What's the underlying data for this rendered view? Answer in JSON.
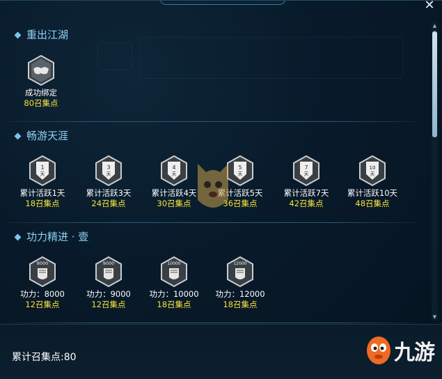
{
  "window": {
    "close_icon": "close-icon"
  },
  "sections": [
    {
      "title": "重出江湖",
      "items": [
        {
          "name": "成功绑定",
          "points": "80召集点",
          "icon": "handshake-badge-icon"
        }
      ]
    },
    {
      "title": "畅游天涯",
      "items": [
        {
          "name": "累计活跃1天",
          "points": "18召集点",
          "icon": "shield-badge-icon",
          "badge_text": "1天"
        },
        {
          "name": "累计活跃3天",
          "points": "24召集点",
          "icon": "shield-badge-icon",
          "badge_text": "3天"
        },
        {
          "name": "累计活跃4天",
          "points": "30召集点",
          "icon": "shield-badge-icon",
          "badge_text": "4天"
        },
        {
          "name": "累计活跃5天",
          "points": "36召集点",
          "icon": "shield-badge-icon",
          "badge_text": "5天"
        },
        {
          "name": "累计活跃7天",
          "points": "42召集点",
          "icon": "shield-badge-icon",
          "badge_text": "7天"
        },
        {
          "name": "累计活跃10天",
          "points": "48召集点",
          "icon": "shield-badge-icon",
          "badge_text": "10天"
        }
      ]
    },
    {
      "title": "功力精进 · 壹",
      "items": [
        {
          "name": "功力：8000",
          "points": "12召集点",
          "icon": "fist-badge-icon",
          "badge_text": "8000"
        },
        {
          "name": "功力：9000",
          "points": "12召集点",
          "icon": "fist-badge-icon",
          "badge_text": "9000"
        },
        {
          "name": "功力：10000",
          "points": "18召集点",
          "icon": "fist-badge-icon",
          "badge_text": "10000"
        },
        {
          "name": "功力：12000",
          "points": "18召集点",
          "icon": "fist-badge-icon",
          "badge_text": "12000"
        }
      ]
    }
  ],
  "footer": {
    "total_label": "累计召集点:80"
  },
  "watermark": {
    "logo_text": "九游"
  },
  "colors": {
    "section_title": "#8fd0f5",
    "points": "#f6e23a",
    "background": "#081a2a"
  }
}
